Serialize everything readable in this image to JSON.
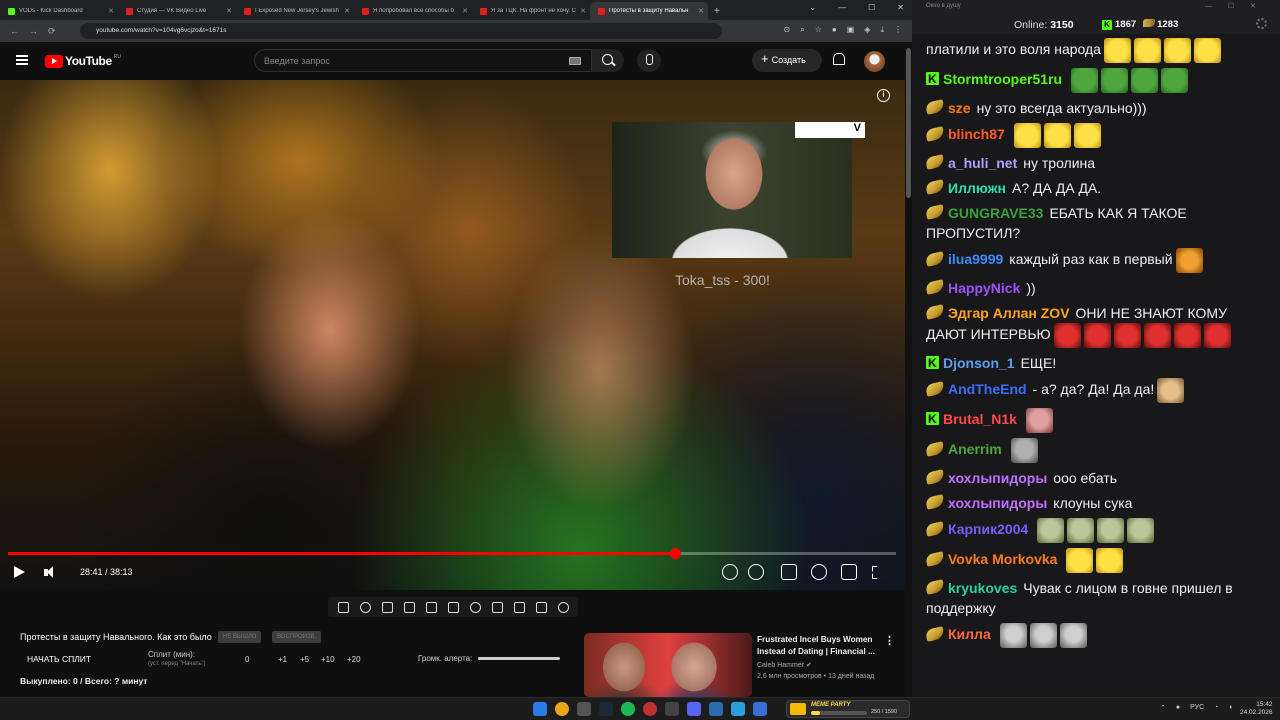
{
  "browser": {
    "tabs": [
      {
        "title": "VODs - Kick Dashboard",
        "icon": "kick-icon",
        "active": false
      },
      {
        "title": "Студия — VK Видео Live",
        "icon": "vk-icon",
        "active": false
      },
      {
        "title": "I Exposed New Jersey's Jewish",
        "icon": "youtube-icon",
        "active": false
      },
      {
        "title": "Я попробовал все способы б",
        "icon": "youtube-icon",
        "active": false
      },
      {
        "title": "Я за ТЦК. На фронт не хочу. С",
        "icon": "youtube-icon",
        "active": false
      },
      {
        "title": "Протесты в защиту Навальн",
        "icon": "youtube-icon",
        "active": true
      }
    ],
    "url": "youtube.com/watch?v=104vg6vcjzo&t=1671s"
  },
  "youtube": {
    "logo": "YouTube",
    "country": "RU",
    "search_placeholder": "Введите запрос",
    "create_label": "Создать"
  },
  "video": {
    "pip_tag": "V",
    "donation": "Toka_tss - 300!",
    "current_time": "28:41",
    "duration": "38:13",
    "time_display": "28:41 / 38:13",
    "progress": 0.751
  },
  "below": {
    "title": "Протесты в защиту Навального. Как это было",
    "chip1": "НЕ ВЫШЛО",
    "chip2": "ВОСПРОИЗВ.",
    "split_button": "НАЧАТЬ СПЛИТ",
    "split_label": "Сплит (мин):",
    "split_sub": "(уст. перед \"Начать\")",
    "split_values": [
      "0",
      "+1",
      "+5",
      "+10",
      "+20"
    ],
    "alert_label": "Громк. алерта:",
    "bought": "Выкуплено: 0 / Всего: ? минут"
  },
  "recommendation": {
    "title": "Frustrated Incel Buys Women Instead of Dating | Financial ...",
    "channel": "Caleb Hammer",
    "meta": "2,6 млн просмотров • 13 дней назад"
  },
  "chat": {
    "window_title": "Окно в душу",
    "online_label": "Online:",
    "online_count": "3150",
    "kick_count": "1867",
    "other_count": "1283",
    "messages": [
      {
        "badge": "none",
        "user": "",
        "color": "#efeff1",
        "text": "платили и это воля народа",
        "emotes": [
          "em-yellow",
          "em-yellow",
          "em-yellow",
          "em-yellow"
        ]
      },
      {
        "badge": "kick",
        "user": "Stormtrooper51ru",
        "color": "#53fc18",
        "text": "",
        "emotes": [
          "em-pepe",
          "em-pepe",
          "em-pepe",
          "em-pepe"
        ]
      },
      {
        "badge": "banana",
        "user": "sze",
        "color": "#ff7a00",
        "text": "ну это всегда актуально)))",
        "emotes": []
      },
      {
        "badge": "banana",
        "user": "blinch87",
        "color": "#ff5a2a",
        "text": "",
        "emotes": [
          "em-yellow",
          "em-yellow",
          "em-yellow"
        ]
      },
      {
        "badge": "banana",
        "user": "a_huli_net",
        "color": "#b49cff",
        "text": "ну тролина",
        "emotes": []
      },
      {
        "badge": "banana",
        "user": "Иллюжн",
        "color": "#2de0b0",
        "text": "А? ДА ДА ДА.",
        "emotes": []
      },
      {
        "badge": "banana",
        "user": "GUNGRAVE33",
        "color": "#3aa23a",
        "text": "ЕБАТЬ КАК Я ТАКОЕ ПРОПУСТИЛ?",
        "emotes": []
      },
      {
        "badge": "banana",
        "user": "ilua9999",
        "color": "#3a8cff",
        "text": "каждый раз как в первый",
        "emotes": [
          "em-tiger"
        ]
      },
      {
        "badge": "banana",
        "user": "HappyNick",
        "color": "#a050ff",
        "text": "))",
        "emotes": []
      },
      {
        "badge": "banana",
        "user": "Эдгар Аллан ZOV",
        "color": "#ffa420",
        "text": "ОНИ НЕ ЗНАЮТ КОМУ ДАЮТ ИНТЕРВЬЮ",
        "emotes": [
          "em-red",
          "em-red",
          "em-red",
          "em-red",
          "em-red",
          "em-red"
        ]
      },
      {
        "badge": "kick",
        "user": "Djonson_1",
        "color": "#5f9ef0",
        "text": "ЕЩЕ!",
        "emotes": []
      },
      {
        "badge": "banana",
        "user": "AndTheEnd",
        "color": "#3a6cff",
        "text": "- а? да? Да! Да да!",
        "emotes": [
          "em-doge"
        ]
      },
      {
        "badge": "kick",
        "user": "Brutal_N1k",
        "color": "#ff4a4a",
        "text": "",
        "emotes": [
          "em-pink"
        ]
      },
      {
        "badge": "banana",
        "user": "Anerrim",
        "color": "#4fa63c",
        "text": "",
        "emotes": [
          "em-grey"
        ]
      },
      {
        "badge": "banana",
        "user": "хохлыпидоры",
        "color": "#c070ff",
        "text": "ооо ебать",
        "emotes": []
      },
      {
        "badge": "banana",
        "user": "хохлыпидоры",
        "color": "#c070ff",
        "text": "клоуны сука",
        "emotes": []
      },
      {
        "badge": "banana",
        "user": "Карпик2004",
        "color": "#7a5cff",
        "text": "",
        "emotes": [
          "em-frog",
          "em-frog",
          "em-frog",
          "em-frog"
        ]
      },
      {
        "badge": "banana",
        "user": "Vovka Morkovka",
        "color": "#ff7a20",
        "text": "",
        "emotes": [
          "em-yellow",
          "em-yellow"
        ]
      },
      {
        "badge": "banana",
        "user": "kryukoves",
        "color": "#2dd0a0",
        "text": "Чувак с лицом в говне пришел в поддержку",
        "emotes": []
      },
      {
        "badge": "banana",
        "user": "Килла",
        "color": "#ff6a40",
        "text": "",
        "emotes": [
          "em-face",
          "em-face",
          "em-face"
        ]
      }
    ]
  },
  "taskbar": {
    "meme_title": "MEME PARTY",
    "meme_count": "250 / 1590",
    "meme_progress": 0.16,
    "lang": "РУС",
    "time": "15:42",
    "date": "24.02.2026"
  },
  "colors": {
    "accent": "#ff0000",
    "kick": "#53fc18",
    "chat_bg": "#18181b"
  }
}
